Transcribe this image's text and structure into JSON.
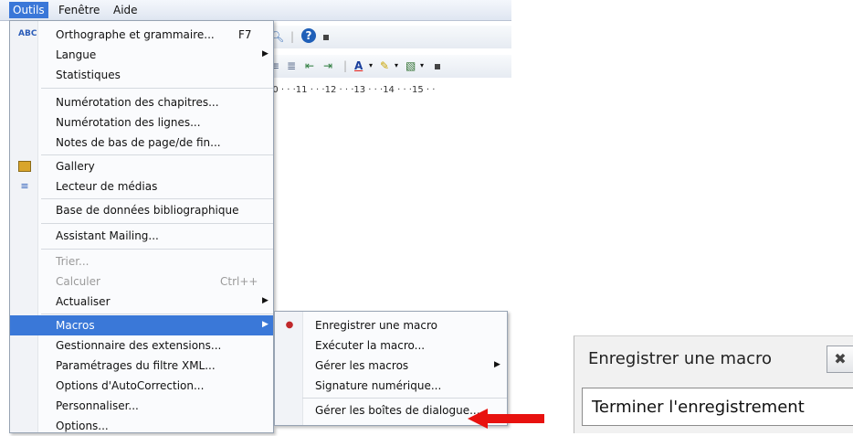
{
  "menubar": {
    "items": [
      "Outils",
      "Fenêtre",
      "Aide"
    ]
  },
  "toolbar": {
    "help_label": "?",
    "ruler_text": "10 · · ·11 · · ·12 · · ·13 · · ·14 · · ·15 · ·"
  },
  "tools_menu": {
    "items": [
      {
        "label": "Orthographe et grammaire...",
        "shortcut": "F7"
      },
      {
        "label": "Langue"
      },
      {
        "label": "Statistiques"
      },
      {
        "label": "Numérotation des chapitres..."
      },
      {
        "label": "Numérotation des lignes..."
      },
      {
        "label": "Notes de bas de page/de fin..."
      },
      {
        "label": "Gallery"
      },
      {
        "label": "Lecteur de médias"
      },
      {
        "label": "Base de données bibliographique"
      },
      {
        "label": "Assistant Mailing..."
      },
      {
        "label": "Trier..."
      },
      {
        "label": "Calculer",
        "shortcut": "Ctrl++"
      },
      {
        "label": "Actualiser"
      },
      {
        "label": "Macros"
      },
      {
        "label": "Gestionnaire des extensions..."
      },
      {
        "label": "Paramétrages du filtre XML..."
      },
      {
        "label": "Options d'AutoCorrection..."
      },
      {
        "label": "Personnaliser..."
      },
      {
        "label": "Options..."
      }
    ]
  },
  "macros_submenu": {
    "items": [
      {
        "label": "Enregistrer une macro"
      },
      {
        "label": "Exécuter la macro..."
      },
      {
        "label": "Gérer les macros"
      },
      {
        "label": "Signature numérique..."
      },
      {
        "label": "Gérer les boîtes de dialogue..."
      }
    ]
  },
  "record_panel": {
    "title": "Enregistrer une macro",
    "stop_button": "Terminer l'enregistrement"
  },
  "colors": {
    "highlight": "#3a78d8",
    "arrow": "#e8120f"
  }
}
